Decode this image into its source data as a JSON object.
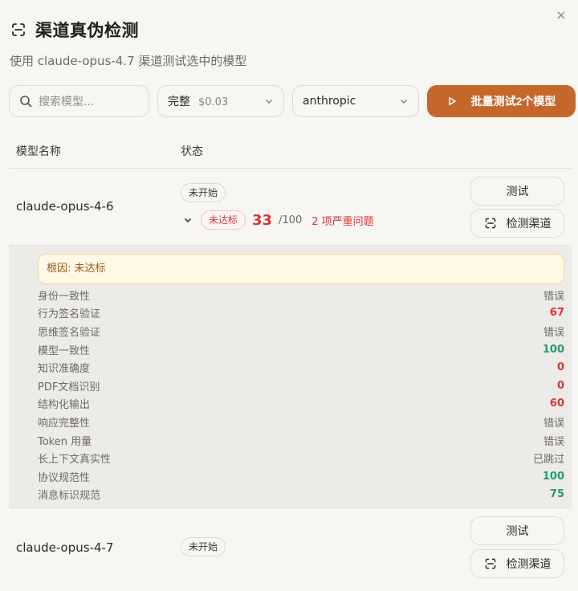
{
  "dialog": {
    "close_glyph": "×",
    "title": "渠道真伪检测",
    "subtitle": "使用 claude-opus-4.7 渠道测试选中的模型"
  },
  "toolbar": {
    "search_placeholder": "搜索模型...",
    "mode_select": {
      "value": "完整",
      "price": "$0.03"
    },
    "provider_select": {
      "value": "anthropic"
    },
    "batch_button_label": "批量测试2个模型"
  },
  "table": {
    "headers": {
      "model": "模型名称",
      "status": "状态"
    },
    "rows": [
      {
        "model": "claude-opus-4-6",
        "status": "未开始",
        "result_badge": "未达标",
        "score": "33",
        "max": "/100",
        "issues": "2 项严重问题",
        "test_label": "测试",
        "detect_label": "检测渠道",
        "detail": {
          "root_cause": "根因: 未达标",
          "metrics": [
            {
              "name": "身份一致性",
              "value": "错误",
              "tone": "err"
            },
            {
              "name": "行为签名验证",
              "value": "67",
              "tone": "red"
            },
            {
              "name": "思维签名验证",
              "value": "错误",
              "tone": "err"
            },
            {
              "name": "模型一致性",
              "value": "100",
              "tone": "green"
            },
            {
              "name": "知识准确度",
              "value": "0",
              "tone": "red"
            },
            {
              "name": "PDF文档识别",
              "value": "0",
              "tone": "red"
            },
            {
              "name": "结构化输出",
              "value": "60",
              "tone": "red"
            },
            {
              "name": "响应完整性",
              "value": "错误",
              "tone": "err"
            },
            {
              "name": "Token 用量",
              "value": "错误",
              "tone": "err"
            },
            {
              "name": "长上下文真实性",
              "value": "已跳过",
              "tone": "skip"
            },
            {
              "name": "协议规范性",
              "value": "100",
              "tone": "green"
            },
            {
              "name": "消息标识规范",
              "value": "75",
              "tone": "green"
            }
          ]
        }
      },
      {
        "model": "claude-opus-4-7",
        "status": "未开始",
        "test_label": "测试",
        "detect_label": "检测渠道"
      }
    ]
  },
  "colors": {
    "accent": "#c5672b",
    "danger": "#d93434",
    "success": "#1f9d6c",
    "warning_bg": "#fff8e6"
  }
}
